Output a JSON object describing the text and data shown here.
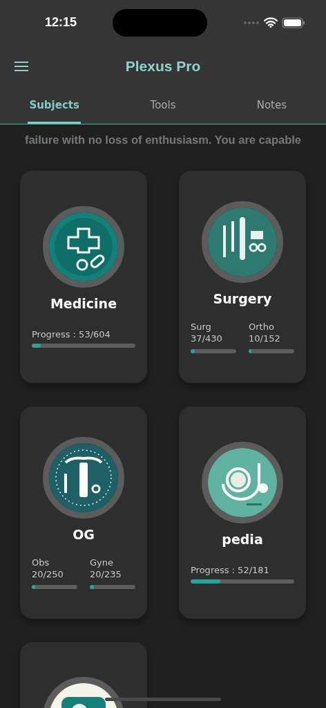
{
  "status_bar": {
    "time": "12:15"
  },
  "app_bar": {
    "title": "Plexus Pro"
  },
  "tabs": [
    {
      "label": "Subjects",
      "selected": true
    },
    {
      "label": "Tools",
      "selected": false
    },
    {
      "label": "Notes",
      "selected": false
    }
  ],
  "ticker": "failure with no loss of enthusiasm. You are capable",
  "subjects": [
    {
      "kind": "single",
      "title": "Medicine",
      "image": {
        "kind": "picture"
      },
      "stats": [
        {
          "label": "Progress : 53/604",
          "level": 0.088
        }
      ]
    },
    {
      "kind": "split",
      "title": "Surgery",
      "image": {
        "kind": "picture"
      },
      "stats": [
        {
          "label": "Surg",
          "count": "37/430",
          "level": 0.086
        },
        {
          "label": "Ortho",
          "count": "10/152",
          "level": 0.066
        }
      ]
    },
    {
      "kind": "split",
      "title": "OG",
      "image": {
        "kind": "picture"
      },
      "stats": [
        {
          "label": "Obs",
          "count": "20/250",
          "level": 0.08
        },
        {
          "label": "Gyne",
          "count": "20/235",
          "level": 0.085
        }
      ]
    },
    {
      "kind": "single",
      "title": "pedia",
      "image": {
        "kind": "picture"
      },
      "stats": [
        {
          "label": "Progress : 52/181",
          "level": 0.287
        }
      ]
    },
    {
      "kind": "cut",
      "image": {
        "kind": "picture"
      }
    }
  ]
}
